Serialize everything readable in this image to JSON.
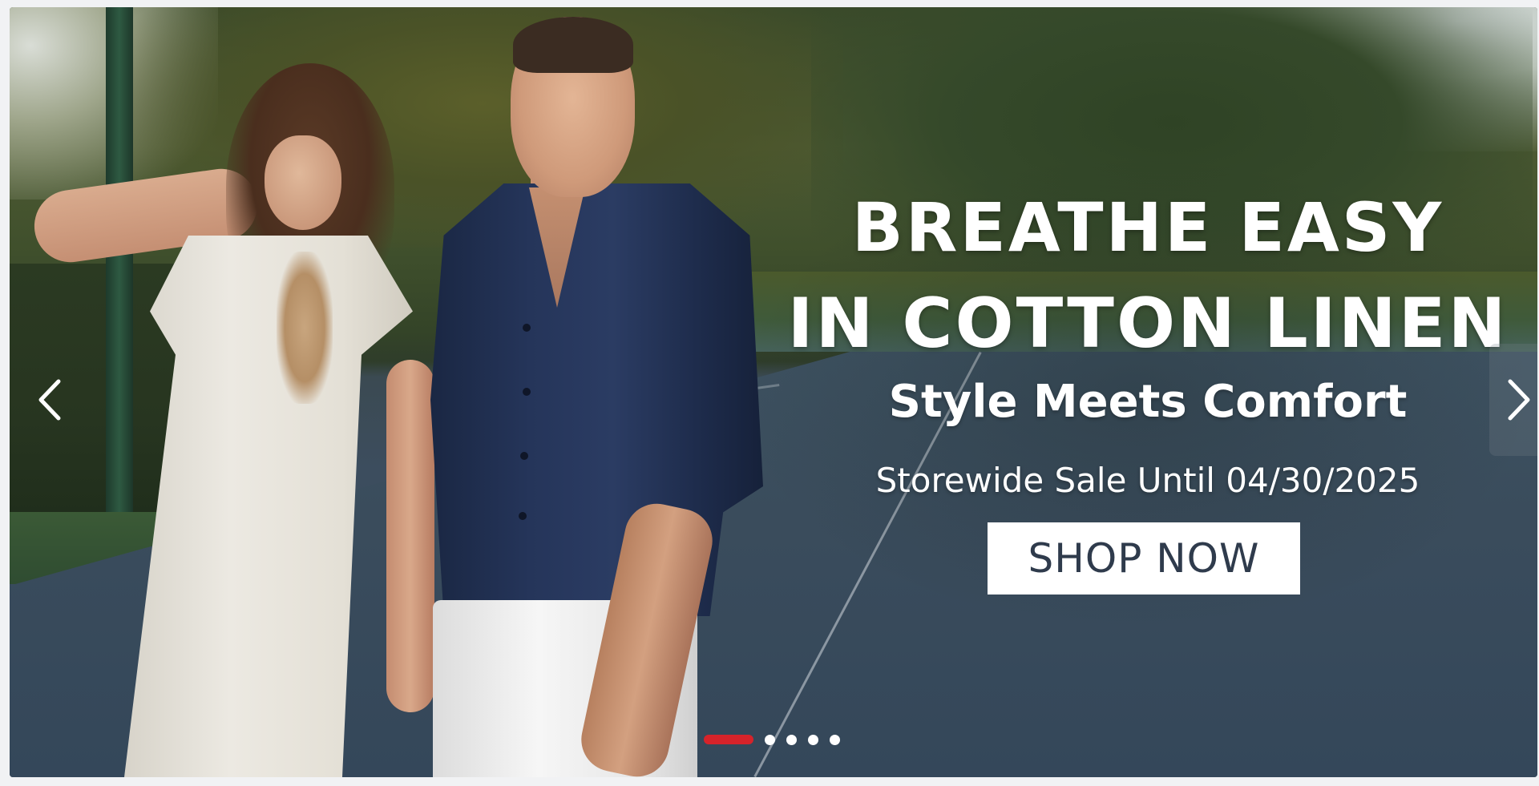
{
  "banner": {
    "headline_line1": "BREATHE EASY",
    "headline_line2": "IN COTTON LINEN",
    "subheadline": "Style Meets Comfort",
    "sale_text": "Storewide Sale Until 04/30/2025",
    "cta_label": "SHOP NOW"
  },
  "carousel": {
    "prev_icon": "chevron-left-icon",
    "next_icon": "chevron-right-icon",
    "slide_count": 5,
    "active_index": 0,
    "accent_color": "#d6232a",
    "dot_color": "#ffffff"
  }
}
